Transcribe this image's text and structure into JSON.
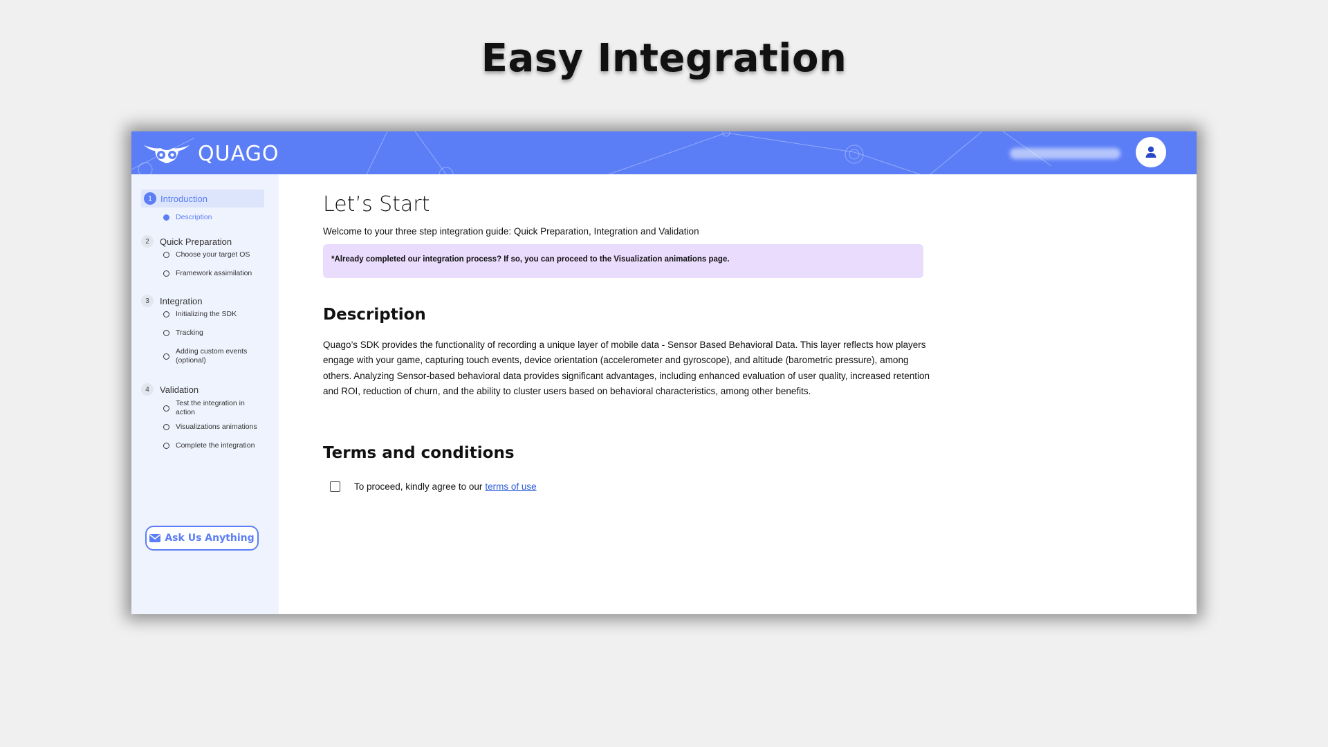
{
  "slide": {
    "title": "Easy Integration"
  },
  "header": {
    "logo_text": "QUAGO",
    "user_icon": "user-icon",
    "color": "#5b7ef7"
  },
  "sidebar": {
    "steps": [
      {
        "num": "1",
        "label": "Introduction",
        "substeps": [
          "Description"
        ]
      },
      {
        "num": "2",
        "label": "Quick Preparation",
        "substeps": [
          "Choose your target OS",
          "Framework assimilation"
        ]
      },
      {
        "num": "3",
        "label": "Integration",
        "substeps": [
          "Initializing the SDK",
          "Tracking",
          "Adding custom events (optional)"
        ]
      },
      {
        "num": "4",
        "label": "Validation",
        "substeps": [
          "Test the integration in action",
          "Visualizations animations",
          "Complete the integration"
        ]
      }
    ],
    "ask_button": "Ask Us Anything"
  },
  "main": {
    "title": "Let’s Start",
    "intro": "Welcome to your three step integration guide: Quick Preparation, Integration and Validation",
    "notice": "*Already completed our integration process? If so, you can proceed to the Visualization animations page.",
    "description_heading": "Description",
    "description_text": "Quago’s SDK provides the functionality of recording a unique layer of mobile data - Sensor Based Behavioral Data. This layer reflects how players engage with your game, capturing touch events, device orientation (accelerometer and gyroscope), and altitude (barometric pressure), among others. Analyzing Sensor-based behavioral data provides significant advantages, including enhanced evaluation of user quality, increased retention and ROI, reduction of churn, and the ability to cluster users based on behavioral characteristics, among other benefits.",
    "terms_heading": "Terms and conditions",
    "terms_text": "To proceed, kindly agree to our",
    "terms_link": "terms of use"
  },
  "colors": {
    "accent": "#5b7ef7",
    "notice_bg": "#eadcfd",
    "sidebar_bg": "#eff3fd"
  }
}
